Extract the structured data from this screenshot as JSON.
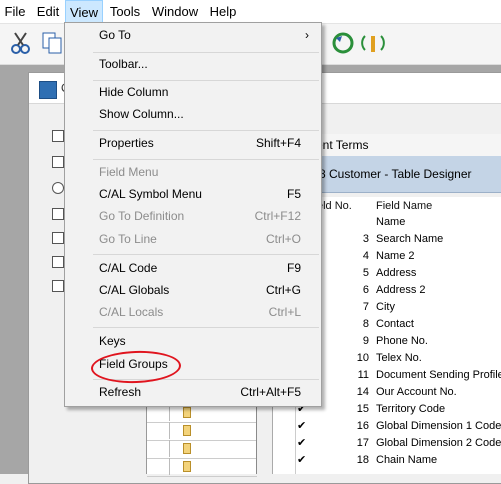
{
  "menubar": {
    "items": [
      "File",
      "Edit",
      "View",
      "Tools",
      "Window",
      "Help"
    ]
  },
  "window": {
    "title": "O"
  },
  "tab": {
    "label": "ent Terms"
  },
  "designer": {
    "title": "8 Customer - Table Designer"
  },
  "grid": {
    "col_field_no": "eld No.",
    "col_field_name": "Field Name",
    "rows": [
      {
        "num": "",
        "name": "Name",
        "check": false
      },
      {
        "num": "3",
        "name": "Search Name",
        "check": false
      },
      {
        "num": "4",
        "name": "Name 2",
        "check": false
      },
      {
        "num": "5",
        "name": "Address",
        "check": false
      },
      {
        "num": "6",
        "name": "Address 2",
        "check": false
      },
      {
        "num": "7",
        "name": "City",
        "check": false
      },
      {
        "num": "8",
        "name": "Contact",
        "check": false
      },
      {
        "num": "9",
        "name": "Phone No.",
        "check": false
      },
      {
        "num": "10",
        "name": "Telex No.",
        "check": false
      },
      {
        "num": "11",
        "name": "Document Sending Profile",
        "check": false
      },
      {
        "num": "14",
        "name": "Our Account No.",
        "check": false
      },
      {
        "num": "15",
        "name": "Territory Code",
        "check": true
      },
      {
        "num": "16",
        "name": "Global Dimension 1 Code",
        "check": true
      },
      {
        "num": "17",
        "name": "Global Dimension 2 Code",
        "check": true
      },
      {
        "num": "18",
        "name": "Chain Name",
        "check": true
      }
    ]
  },
  "view_menu": {
    "go_to": "Go To",
    "toolbar": "Toolbar...",
    "hide_column": "Hide Column",
    "show_column": "Show Column...",
    "properties": "Properties",
    "properties_sc": "Shift+F4",
    "field_menu": "Field Menu",
    "cal_symbol_menu": "C/AL Symbol Menu",
    "cal_symbol_menu_sc": "F5",
    "go_to_definition": "Go To Definition",
    "go_to_definition_sc": "Ctrl+F12",
    "go_to_line": "Go To Line",
    "go_to_line_sc": "Ctrl+O",
    "cal_code": "C/AL Code",
    "cal_code_sc": "F9",
    "cal_globals": "C/AL Globals",
    "cal_globals_sc": "Ctrl+G",
    "cal_locals": "C/AL Locals",
    "cal_locals_sc": "Ctrl+L",
    "keys": "Keys",
    "field_groups": "Field Groups",
    "refresh": "Refresh",
    "refresh_sc": "Ctrl+Alt+F5"
  },
  "colors": {
    "menu_highlight": "#cce8ff",
    "annotation": "#e0141e",
    "designer_title_bg": "#c4d4e6"
  }
}
